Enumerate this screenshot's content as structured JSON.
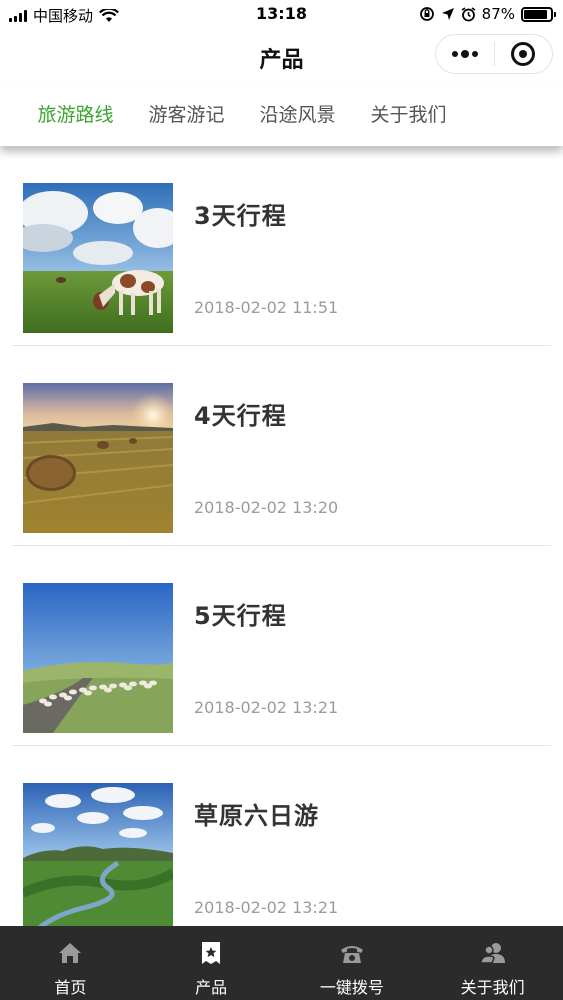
{
  "status_bar": {
    "carrier": "中国移动",
    "time": "13:18",
    "battery": "87%",
    "battery_level": 0.87
  },
  "nav": {
    "title": "产品"
  },
  "tabs": [
    {
      "label": "旅游路线",
      "active": true
    },
    {
      "label": "游客游记",
      "active": false
    },
    {
      "label": "沿途风景",
      "active": false
    },
    {
      "label": "关于我们",
      "active": false
    }
  ],
  "accent_color": "#3aa52f",
  "items": [
    {
      "title": "3天行程",
      "date": "2018-02-02 11:51",
      "image": "grassland-cow-photo"
    },
    {
      "title": "4天行程",
      "date": "2018-02-02 13:20",
      "image": "hay-bale-sunset-photo"
    },
    {
      "title": "5天行程",
      "date": "2018-02-02 13:21",
      "image": "sheep-road-photo"
    },
    {
      "title": "草原六日游",
      "date": "2018-02-02 13:21",
      "image": "river-valley-photo"
    }
  ],
  "bottom_tabs": [
    {
      "label": "首页",
      "icon": "home-icon"
    },
    {
      "label": "产品",
      "icon": "product-icon"
    },
    {
      "label": "一键拨号",
      "icon": "phone-icon"
    },
    {
      "label": "关于我们",
      "icon": "users-icon"
    }
  ]
}
